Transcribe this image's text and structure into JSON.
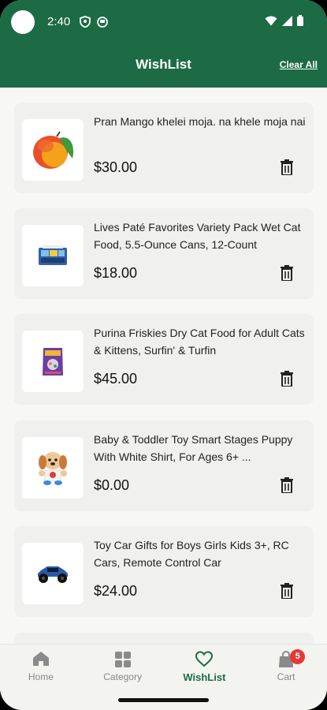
{
  "status_bar": {
    "time": "2:40"
  },
  "header": {
    "title": "WishList",
    "clear_all": "Clear All"
  },
  "items": [
    {
      "title": "Pran Mango khelei moja. na khele moja nai",
      "price": "$30.00",
      "icon": "mango-image"
    },
    {
      "title": "Lives Paté Favorites Variety Pack Wet Cat Food, 5.5-Ounce Cans, 12-Count",
      "price": "$18.00",
      "icon": "cat-food-pack-image"
    },
    {
      "title": "Purina Friskies Dry Cat Food for Adult Cats & Kittens, Surfin' & Turfin",
      "price": "$45.00",
      "icon": "cat-food-bag-image"
    },
    {
      "title": "Baby & Toddler Toy Smart Stages Puppy With White Shirt, For Ages 6+ ...",
      "price": "$0.00",
      "icon": "puppy-toy-image"
    },
    {
      "title": "Toy Car Gifts for Boys Girls Kids 3+, RC Cars, Remote Control Car",
      "price": "$24.00",
      "icon": "rc-car-image"
    }
  ],
  "nav": {
    "home": "Home",
    "category": "Category",
    "wishlist": "WishList",
    "cart": "Cart",
    "cart_badge": "5"
  },
  "colors": {
    "primary": "#1d6b44",
    "badge": "#e53935"
  }
}
